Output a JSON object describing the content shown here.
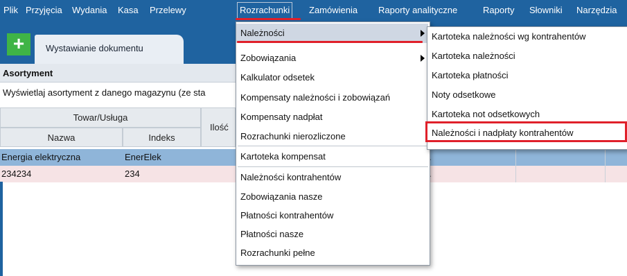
{
  "menubar": {
    "items": [
      "Plik",
      "Przyjęcia",
      "Wydania",
      "Kasa",
      "Przelewy",
      "Rozrachunki",
      "Zamówienia",
      "Raporty analityczne",
      "Raporty",
      "Słowniki",
      "Narzędzia"
    ],
    "active": "Rozrachunki"
  },
  "tabs": {
    "add_label": "+",
    "active_tab": "Wystawianie dokumentu"
  },
  "section": {
    "title": "Asortyment",
    "filter_text": "Wyświetlaj asortyment z danego magazynu (ze sta"
  },
  "grid": {
    "group_header": "Towar/Usługa",
    "col_nazwa": "Nazwa",
    "col_indeks": "Indeks",
    "col_ilosc": "Ilość",
    "rows": [
      {
        "nazwa": "Energia elektryczna",
        "indeks": "EnerElek",
        "extra": "\\"
      },
      {
        "nazwa": "234234",
        "indeks": "234",
        "extra": "\\"
      }
    ]
  },
  "menu_rozrachunki": {
    "items": [
      "Należności",
      "Zobowiązania",
      "Kalkulator odsetek",
      "Kompensaty należności i zobowiązań",
      "Kompensaty nadpłat",
      "Rozrachunki nierozliczone",
      "Kartoteka kompensat",
      "Należności kontrahentów",
      "Zobowiązania nasze",
      "Płatności kontrahentów",
      "Płatności nasze",
      "Rozrachunki pełne"
    ]
  },
  "menu_naleznosci": {
    "items": [
      "Kartoteka należności wg kontrahentów",
      "Kartoteka należności",
      "Kartoteka płatności",
      "Noty odsetkowe",
      "Kartoteka not odsetkowych",
      "Należności i nadpłaty kontrahentów"
    ]
  },
  "colors": {
    "menubar": "#1f63a0",
    "highlight_red": "#e0202a",
    "selected_row": "#8fb5d9",
    "add_button": "#3fb446"
  }
}
